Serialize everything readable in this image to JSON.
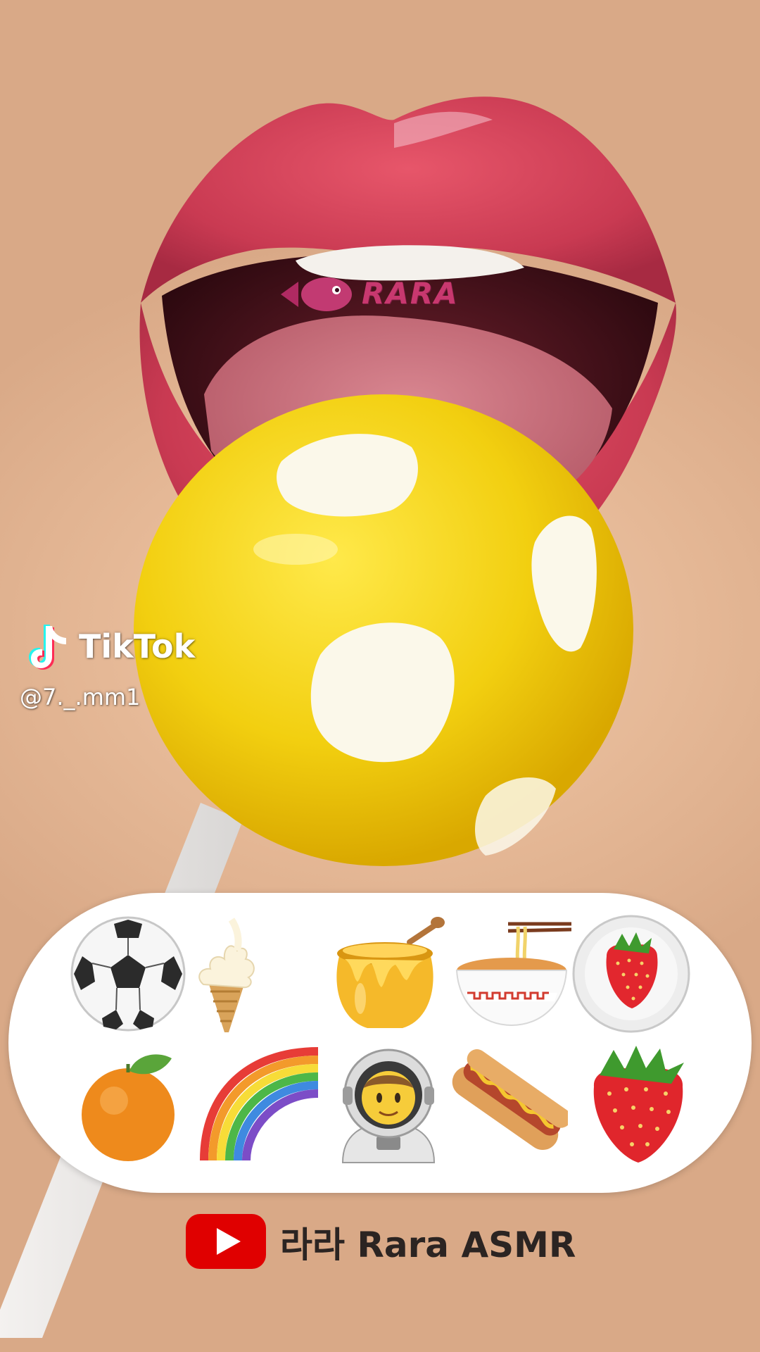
{
  "watermark": {
    "text": "RARA"
  },
  "tiktok": {
    "name": "TikTok",
    "handle": "@7._.mm1"
  },
  "emoji_panel": {
    "items": [
      {
        "icon": "soccer-ball-icon"
      },
      {
        "icon": "soft-ice-cream-icon"
      },
      {
        "icon": "honey-pot-icon"
      },
      {
        "icon": "noodle-bowl-icon"
      },
      {
        "icon": "strawberry-on-plate-icon"
      },
      {
        "icon": "tangerine-icon"
      },
      {
        "icon": "rainbow-icon"
      },
      {
        "icon": "astronaut-icon"
      },
      {
        "icon": "hot-dog-icon"
      },
      {
        "icon": "strawberry-icon"
      }
    ]
  },
  "channel": {
    "name": "라라 Rara ASMR",
    "logo_color": "#e00000"
  }
}
